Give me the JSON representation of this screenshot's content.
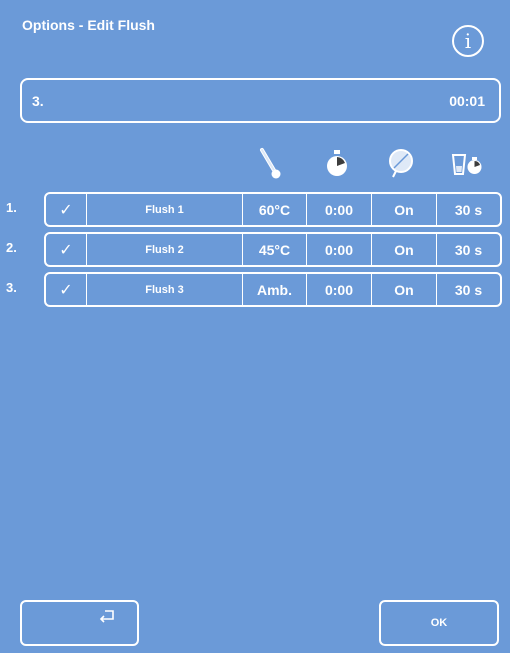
{
  "header": {
    "title": "Options - Edit Flush",
    "info_icon": "info-icon",
    "info_glyph": "i"
  },
  "status": {
    "step": "3.",
    "time": "00:01"
  },
  "columns": {
    "temperature_icon": "thermometer-icon",
    "timer_icon": "stopwatch-icon",
    "valve_icon": "valve-icon",
    "drain_icon": "drain-timer-icon"
  },
  "rows": [
    {
      "num": "1.",
      "check": "✓",
      "name": "Flush 1",
      "temp": "60°C",
      "time": "0:00",
      "state": "On",
      "duration": "30 s"
    },
    {
      "num": "2.",
      "check": "✓",
      "name": "Flush 2",
      "temp": "45°C",
      "time": "0:00",
      "state": "On",
      "duration": "30 s"
    },
    {
      "num": "3.",
      "check": "✓",
      "name": "Flush 3",
      "temp": "Amb.",
      "time": "0:00",
      "state": "On",
      "duration": "30 s"
    }
  ],
  "footer": {
    "back_icon": "return-arrow-icon",
    "ok_label": "OK"
  },
  "colors": {
    "background": "#6b9ad8",
    "foreground": "#ffffff"
  }
}
